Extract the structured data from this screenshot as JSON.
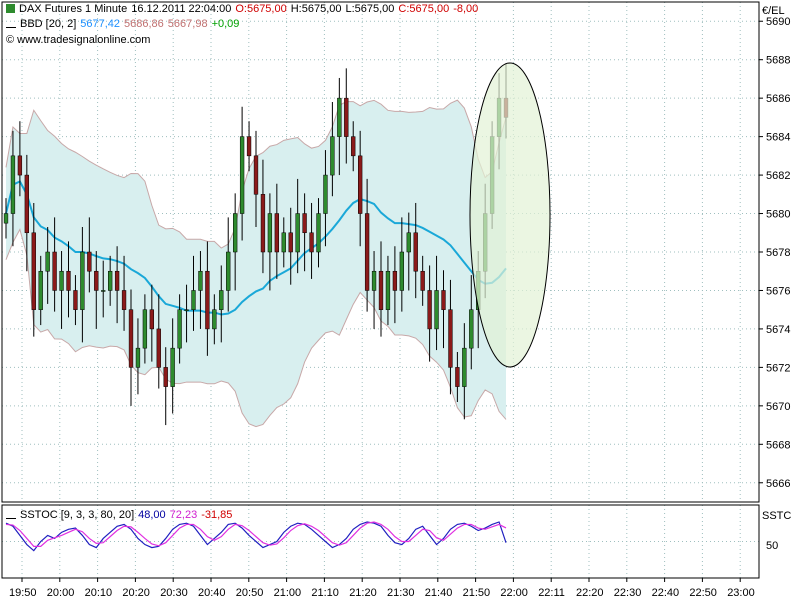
{
  "header": {
    "line1": {
      "symbol": "DAX Futures 1 Minute",
      "datetime": "16.12.2011 22:04:00",
      "open": "O:5675,00",
      "high": "H:5675,00",
      "low": "L:5675,00",
      "close": "C:5675,00",
      "change": "-8,00"
    },
    "line2": {
      "indicator": "BBD [20, 2]",
      "middle": "5677,42",
      "upper": "5686,86",
      "lower": "5667,98",
      "diff": "+0,09"
    },
    "copyright": "© www.tradesignalonline.com"
  },
  "stoch_header": {
    "indicator": "SSTOC [9, 3, 3, 80, 20]",
    "k": "48,00",
    "d": "72,23",
    "diff": "-31,85"
  },
  "axis": {
    "price_unit": "€/EL",
    "stoch_unit": "SSTC",
    "stoch_tick": "50"
  },
  "colors": {
    "background": "#ffffff",
    "grid": "#9fbfbf",
    "up_candle": "#2e8b2e",
    "down_candle": "#8b1a1a",
    "band_fill": "#d8efef",
    "band_line": "#c7a8a8",
    "mid_line": "#1aa8d8",
    "stoch_k": "#2020c0",
    "stoch_d": "#e030e0",
    "highlight_ellipse": "#e2f2d6",
    "header_red": "#d00000",
    "header_green": "#00a000",
    "header_blue": "#1e90ff",
    "header_pink": "#c07070",
    "header_magenta": "#d020d0",
    "header_navy": "#0000a0"
  },
  "chart_data": [
    {
      "type": "candlestick",
      "title": "DAX Futures 1 Minute",
      "ylabel": "€/EL",
      "ylim": [
        5665,
        5691
      ],
      "y_ticks": [
        5666,
        5668,
        5670,
        5672,
        5674,
        5676,
        5678,
        5680,
        5682,
        5684,
        5686,
        5688,
        5690
      ],
      "x_ticks": [
        "19:50",
        "20:00",
        "20:10",
        "20:20",
        "20:30",
        "20:40",
        "20:50",
        "21:00",
        "21:10",
        "21:20",
        "21:30",
        "21:40",
        "21:50",
        "22:00",
        "22:11",
        "22:20",
        "22:30",
        "22:40",
        "22:50",
        "23:00"
      ],
      "grid": true,
      "series": [
        {
          "name": "BBD [20, 2]",
          "upper": 5686.86,
          "middle": 5677.42,
          "lower": 5667.98
        },
        {
          "name": "DAX Futures 1 Minute",
          "last": {
            "open": 5675.0,
            "high": 5675.0,
            "low": 5675.0,
            "close": 5675.0,
            "change": -8.0
          }
        }
      ],
      "close": [
        5680,
        5683,
        5682,
        5679,
        5675,
        5677,
        5678,
        5676,
        5677,
        5676,
        5675,
        5678,
        5677,
        5676,
        5676,
        5677,
        5676,
        5675,
        5672,
        5673,
        5675,
        5674,
        5672,
        5671,
        5673,
        5675,
        5675,
        5676,
        5677,
        5674,
        5675,
        5676,
        5678,
        5680,
        5684,
        5683,
        5681,
        5678,
        5680,
        5678,
        5679,
        5678,
        5680,
        5679,
        5678,
        5680,
        5682,
        5684,
        5686,
        5684,
        5683,
        5680,
        5676,
        5677,
        5675,
        5677,
        5676,
        5678,
        5679,
        5677,
        5676,
        5674,
        5676,
        5675,
        5672,
        5671,
        5673,
        5675,
        5677,
        5680,
        5684,
        5686,
        5685
      ],
      "annotations": [
        "highlight ellipse around 21:50 - 22:04"
      ]
    },
    {
      "type": "line",
      "title": "SSTOC [9, 3, 3, 80, 20]",
      "ylabel": "SSTC",
      "ylim": [
        0,
        100
      ],
      "y_ticks": [
        50
      ],
      "series": [
        {
          "name": "SSTOC [9, 3, 3, 80, 20]",
          "last": 48.0
        },
        {
          "name": "SSTOC [9, 3, 3, 80, 20]",
          "last": 72.23
        }
      ],
      "k_values": [
        80,
        75,
        60,
        45,
        35,
        50,
        60,
        55,
        65,
        70,
        72,
        60,
        45,
        40,
        55,
        65,
        75,
        78,
        70,
        55,
        45,
        40,
        42,
        55,
        70,
        78,
        80,
        75,
        60,
        45,
        55,
        65,
        78,
        80,
        72,
        60,
        50,
        40,
        45,
        50,
        65,
        75,
        80,
        78,
        70,
        60,
        50,
        40,
        45,
        55,
        70,
        78,
        82,
        80,
        75,
        60,
        48,
        45,
        55,
        70,
        75,
        60,
        45,
        55,
        70,
        78,
        80,
        75,
        68,
        72,
        78,
        82,
        48
      ],
      "d_values": [
        78,
        77,
        68,
        55,
        42,
        42,
        52,
        56,
        60,
        65,
        70,
        66,
        55,
        47,
        48,
        58,
        68,
        75,
        74,
        65,
        55,
        46,
        43,
        48,
        60,
        72,
        78,
        78,
        70,
        58,
        52,
        58,
        70,
        78,
        76,
        68,
        58,
        48,
        44,
        46,
        56,
        68,
        76,
        79,
        75,
        68,
        58,
        48,
        44,
        48,
        60,
        72,
        80,
        82,
        78,
        70,
        58,
        50,
        50,
        60,
        70,
        68,
        56,
        52,
        62,
        72,
        78,
        78,
        72,
        70,
        74,
        78,
        72.23
      ]
    }
  ]
}
